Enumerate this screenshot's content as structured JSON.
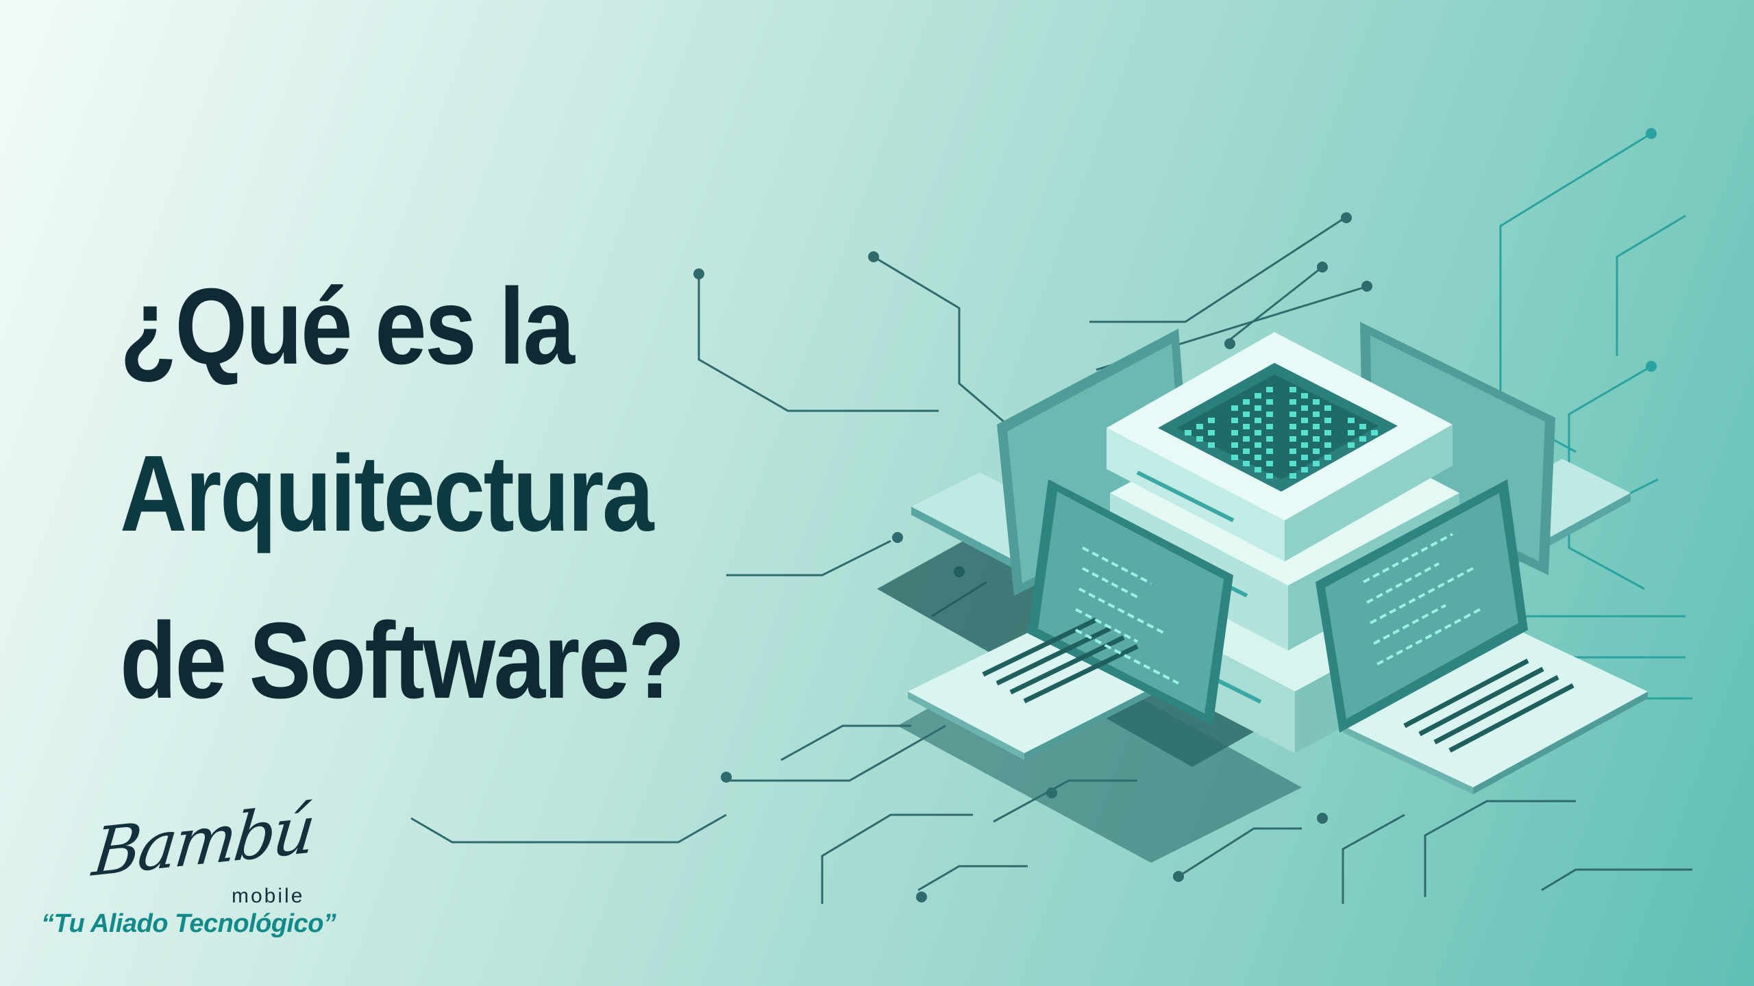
{
  "headline": {
    "line1": "¿Qué es la",
    "line2": "Arquitectura",
    "line3": "de Software?"
  },
  "logo": {
    "script": "Bambú",
    "sub": "mobile",
    "tagline": "“Tu Aliado Tecnológico”"
  },
  "colors": {
    "headline": "#0f2a33",
    "tagline": "#138a8a",
    "background_start": "#f2fbf9",
    "background_end": "#5fbfb4"
  },
  "illustration": {
    "icon": "isometric-server-laptops-icon"
  }
}
